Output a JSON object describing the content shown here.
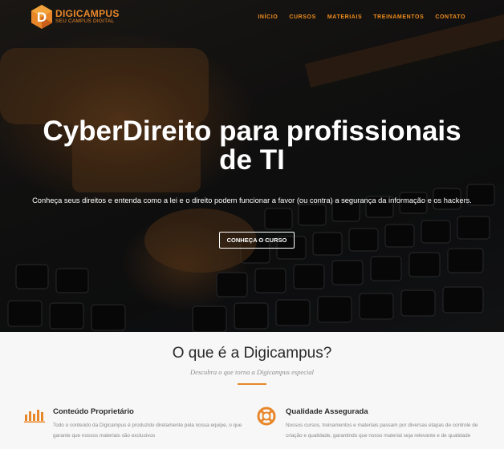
{
  "brand": {
    "name": "DIGICAMPUS",
    "tagline": "SEU CAMPUS DIGITAL",
    "logo_letter": "D"
  },
  "nav": [
    {
      "label": "INÍCIO"
    },
    {
      "label": "CURSOS"
    },
    {
      "label": "MATERIAIS"
    },
    {
      "label": "TREINAMENTOS"
    },
    {
      "label": "CONTATO"
    }
  ],
  "hero": {
    "title": "CyberDireito para profissionais de TI",
    "subtitle": "Conheça seus direitos e entenda como a lei e o direito podem funcionar a favor (ou contra) a segurança da informação e os hackers.",
    "cta_label": "CONHEÇA O CURSO"
  },
  "about": {
    "title": "O que é a Digicampus?",
    "subtitle": "Descubra o que torna a Digicampus especial"
  },
  "features": [
    {
      "icon": "bar-chart-icon",
      "title": "Conteúdo Proprietário",
      "description": "Todo o conteúdo da Digicampus é produzido diretamente pela nossa equipe, o que garante que nossos materiais são exclusivos"
    },
    {
      "icon": "lifebuoy-icon",
      "title": "Qualidade Assegurada",
      "description": "Nossos cursos, treinamentos e materiais passam por diversas etapas de controle de criação e qualidade, garantindo que nosso material seja relevante e de qualidade"
    }
  ],
  "colors": {
    "accent": "#e8872a",
    "nav": "#f08c1e",
    "text_dark": "#2a2a2a",
    "text_muted": "#888888"
  }
}
